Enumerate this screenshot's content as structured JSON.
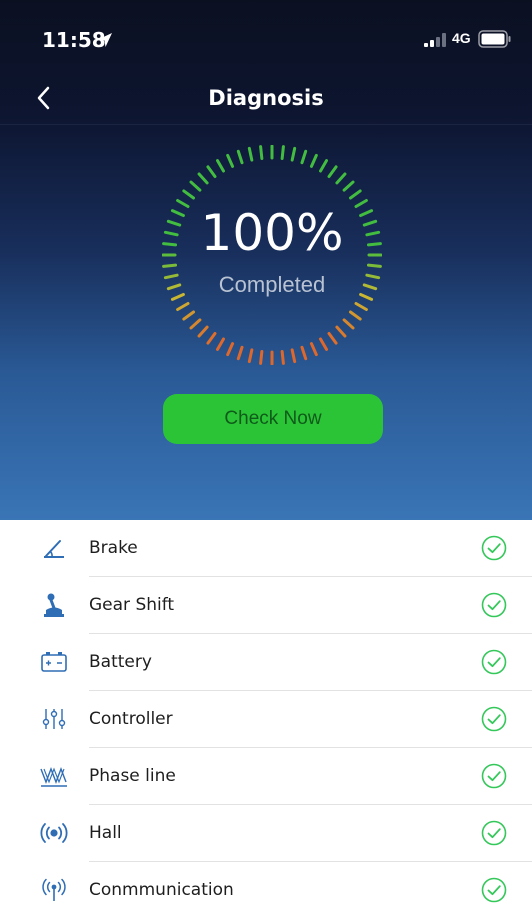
{
  "status": {
    "time": "11:58",
    "network": "4G"
  },
  "nav": {
    "title": "Diagnosis"
  },
  "gauge": {
    "value": "100%",
    "caption": "Completed",
    "progress": 1.0
  },
  "action": {
    "check_label": "Check Now"
  },
  "colors": {
    "accent_green": "#2cc437",
    "check_green": "#34c759",
    "icon_blue": "#2f6db5"
  },
  "items": [
    {
      "label": "Brake",
      "icon": "brake-icon",
      "status": "ok"
    },
    {
      "label": "Gear Shift",
      "icon": "gear-shift-icon",
      "status": "ok"
    },
    {
      "label": "Battery",
      "icon": "battery-icon",
      "status": "ok"
    },
    {
      "label": "Controller",
      "icon": "controller-icon",
      "status": "ok"
    },
    {
      "label": "Phase line",
      "icon": "phase-line-icon",
      "status": "ok"
    },
    {
      "label": "Hall",
      "icon": "hall-icon",
      "status": "ok"
    },
    {
      "label": "Conmmunication",
      "icon": "communication-icon",
      "status": "ok"
    }
  ]
}
